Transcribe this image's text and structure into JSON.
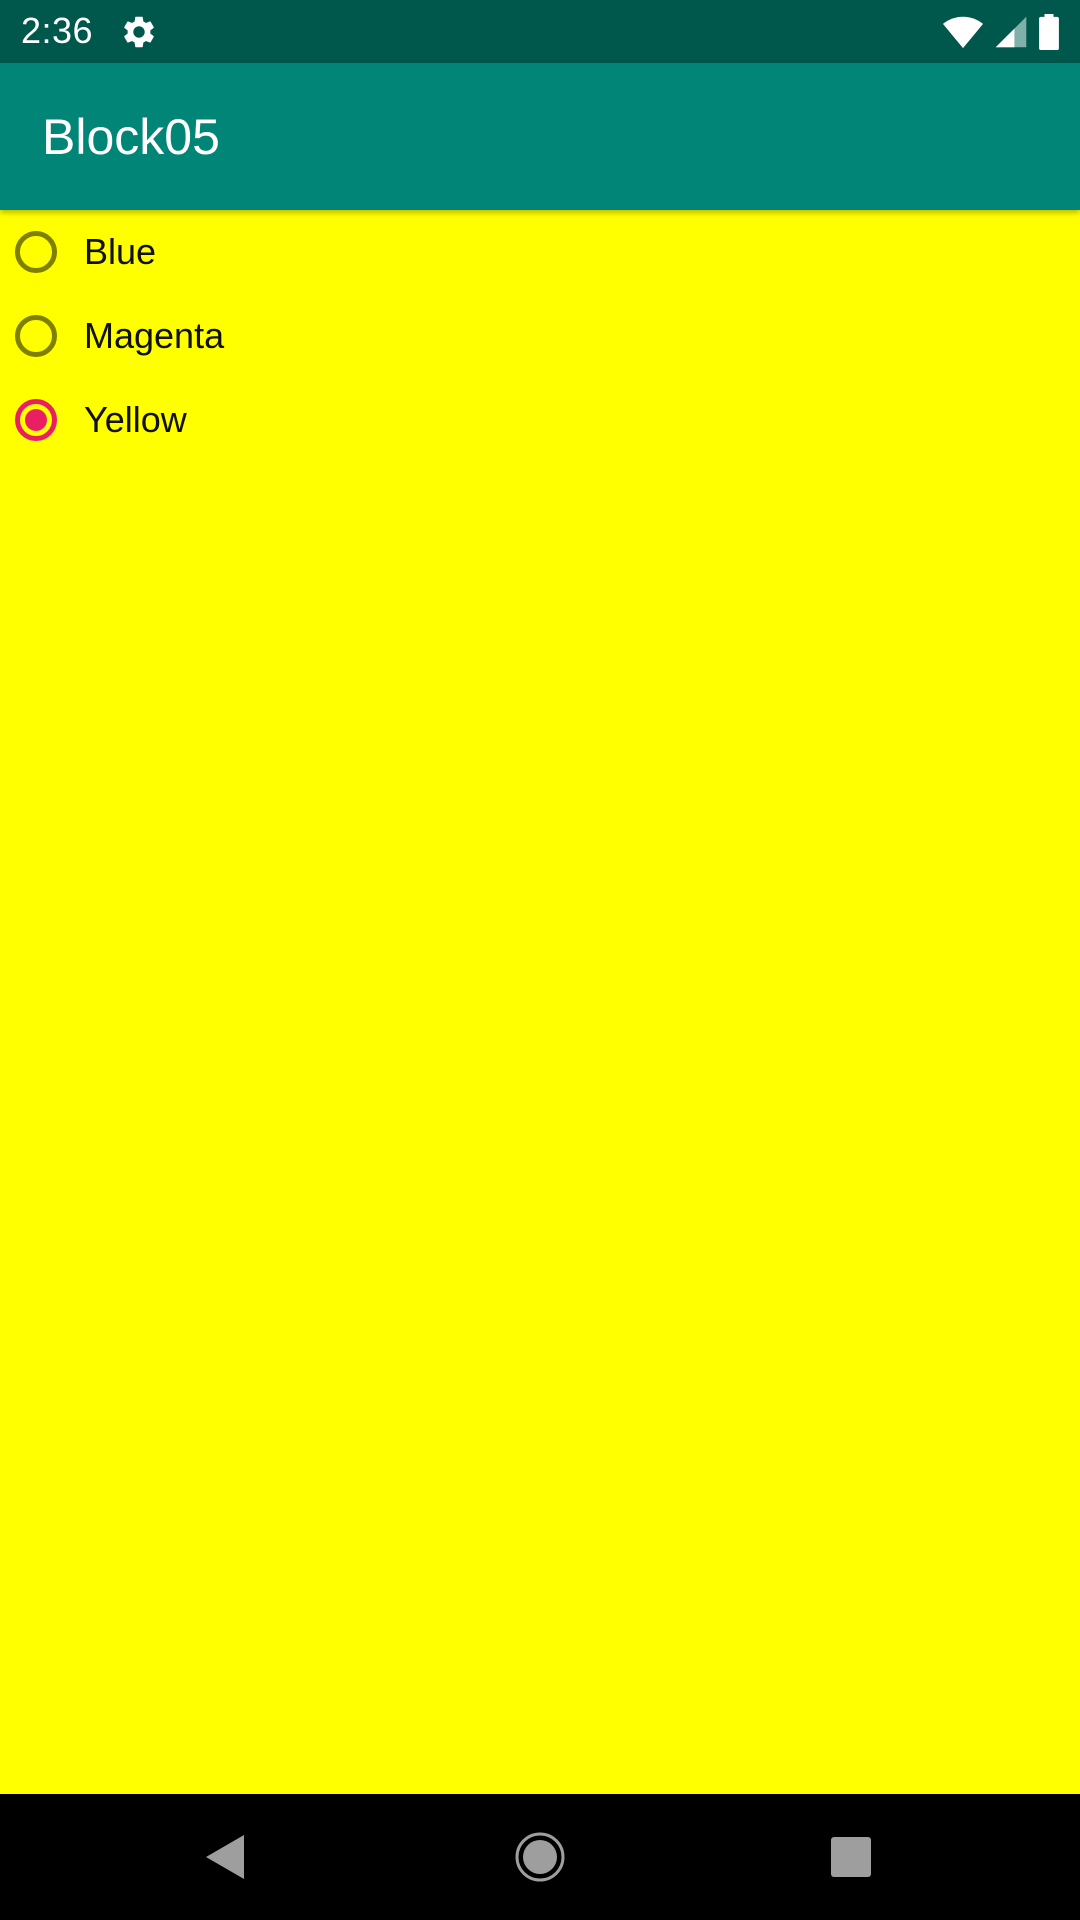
{
  "colors": {
    "status_bar_bg": "#00574b",
    "app_bar_bg": "#008577",
    "content_bg": "#ffff00",
    "radio_unchecked": "#808000",
    "radio_checked": "#e91e63",
    "nav_bar_bg": "#000000"
  },
  "status_bar": {
    "time": "2:36",
    "icons": [
      "settings-gear-icon",
      "wifi-icon",
      "cellular-signal-icon",
      "battery-icon"
    ]
  },
  "app_bar": {
    "title": "Block05"
  },
  "radio_group": {
    "selected": "Yellow",
    "options": [
      {
        "label": "Blue",
        "checked": false
      },
      {
        "label": "Magenta",
        "checked": false
      },
      {
        "label": "Yellow",
        "checked": true
      }
    ]
  },
  "nav_bar": {
    "icons": [
      "back-icon",
      "home-icon",
      "recents-icon"
    ]
  }
}
